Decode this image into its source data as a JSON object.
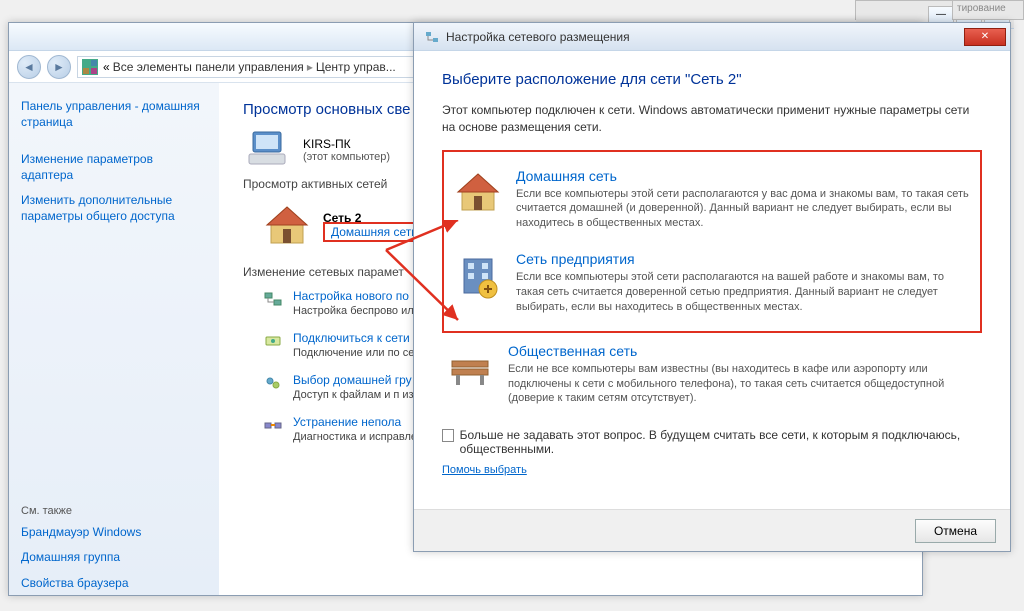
{
  "bgWindow": {
    "closeGlyph": "✕",
    "maxGlyph": "▭",
    "minGlyph": "—"
  },
  "controlPanel": {
    "breadcrumb": {
      "prefix": "«",
      "item1": "Все элементы панели управления",
      "item2": "Центр управ..."
    },
    "searchPlaceholder": "",
    "sidebar": {
      "homeLink": "Панель управления - домашняя страница",
      "link1": "Изменение параметров адаптера",
      "link2": "Изменить дополнительные параметры общего доступа",
      "seeAlso": "См. также",
      "link3": "Брандмауэр Windows",
      "link4": "Домашняя группа",
      "link5": "Свойства браузера"
    },
    "main": {
      "heading": "Просмотр основных све",
      "pcName": "KIRS-ПК",
      "pcSub": "(этот компьютер)",
      "activeNets": "Просмотр активных сетей",
      "netName": "Сеть  2",
      "netType": "Домашняя сеть",
      "changeParams": "Изменение сетевых парамет",
      "task1": {
        "link": "Настройка нового по",
        "desc": "Настройка беспрово\nили же настройка ма"
      },
      "task2": {
        "link": "Подключиться к сети",
        "desc": "Подключение или по\nсетевому соединени"
      },
      "task3": {
        "link": "Выбор домашней гру",
        "desc": "Доступ к файлам и п\nизменение параметр"
      },
      "task4": {
        "link": "Устранение непола",
        "desc": "Диагностика и исправление сетевых проблем или получение сведений об исправлении."
      }
    }
  },
  "dialog": {
    "title": "Настройка сетевого размещения",
    "heading": "Выберите расположение для сети \"Сеть  2\"",
    "intro": "Этот компьютер подключен к сети. Windows автоматически применит нужные параметры сети на основе размещения сети.",
    "choices": [
      {
        "title": "Домашняя сеть",
        "desc": "Если все компьютеры этой сети располагаются у вас дома и знакомы вам, то такая сеть считается домашней (и доверенной). Данный вариант не следует выбирать, если вы находитесь в общественных местах."
      },
      {
        "title": "Сеть предприятия",
        "desc": "Если все компьютеры этой сети располагаются на вашей работе и знакомы вам, то такая сеть считается доверенной сетью предприятия. Данный вариант не следует выбирать, если вы находитесь в общественных местах."
      },
      {
        "title": "Общественная сеть",
        "desc": "Если не все компьютеры вам известны (вы находитесь в кафе или аэропорту или подключены к сети с мобильного телефона), то такая сеть считается общедоступной (доверие к таким сетям отсутствует)."
      }
    ],
    "checkbox": "Больше не задавать этот вопрос. В будущем считать все сети, к которым я подключаюсь, общественными.",
    "helpLink": "Помочь выбрать",
    "cancel": "Отмена"
  }
}
